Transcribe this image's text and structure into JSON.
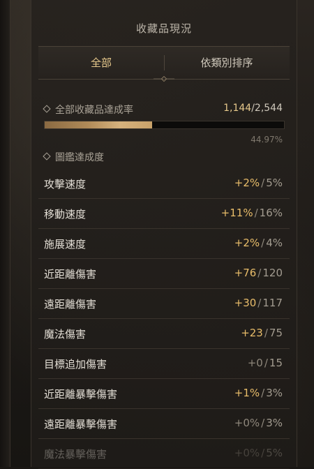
{
  "panel": {
    "title": "收藏品現況",
    "tabs": [
      {
        "label": "全部",
        "active": true
      },
      {
        "label": "依類別排序",
        "active": false
      }
    ]
  },
  "collection": {
    "label": "全部收藏品達成率",
    "current": "1,144",
    "total": "2,544",
    "progress_fraction": 0.4497,
    "percent_text": "44.97%"
  },
  "codex": {
    "label": "圖鑑達成度",
    "rows": [
      {
        "name": "攻擊速度",
        "current": "+2%",
        "max": "5%"
      },
      {
        "name": "移動速度",
        "current": "+11%",
        "max": "16%"
      },
      {
        "name": "施展速度",
        "current": "+2%",
        "max": "4%"
      },
      {
        "name": "近距離傷害",
        "current": "+76",
        "max": "120"
      },
      {
        "name": "遠距離傷害",
        "current": "+30",
        "max": "117"
      },
      {
        "name": "魔法傷害",
        "current": "+23",
        "max": "75"
      },
      {
        "name": "目標追加傷害",
        "current": "+0",
        "max": "15"
      },
      {
        "name": "近距離暴擊傷害",
        "current": "+1%",
        "max": "3%"
      },
      {
        "name": "遠距離暴擊傷害",
        "current": "+0%",
        "max": "3%"
      },
      {
        "name": "魔法暴擊傷害",
        "current": "+0%",
        "max": "5%"
      }
    ]
  },
  "colors": {
    "accent_gold": "#e9bd6a",
    "tab_active": "#e7c98c",
    "muted": "#8f887c"
  }
}
